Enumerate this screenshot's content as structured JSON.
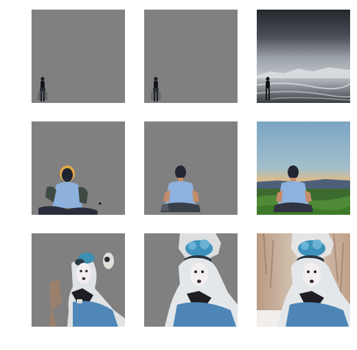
{
  "figure": {
    "rows": [
      {
        "name": "person-walking-on-beach",
        "panels": [
          {
            "kind": "mask-a",
            "bg": "#808080"
          },
          {
            "kind": "mask-b",
            "bg": "#808080"
          },
          {
            "kind": "original",
            "bg": "#5d6066"
          }
        ]
      },
      {
        "name": "meditating-man",
        "panels": [
          {
            "kind": "mask-a",
            "bg": "#808080"
          },
          {
            "kind": "mask-b",
            "bg": "#808080"
          },
          {
            "kind": "original",
            "bg": "#8fb4c9"
          }
        ]
      },
      {
        "name": "woman-with-blue-flowers",
        "panels": [
          {
            "kind": "mask-a",
            "bg": "#808080"
          },
          {
            "kind": "mask-b",
            "bg": "#808080"
          },
          {
            "kind": "original",
            "bg": "#b39b86"
          }
        ]
      }
    ]
  }
}
